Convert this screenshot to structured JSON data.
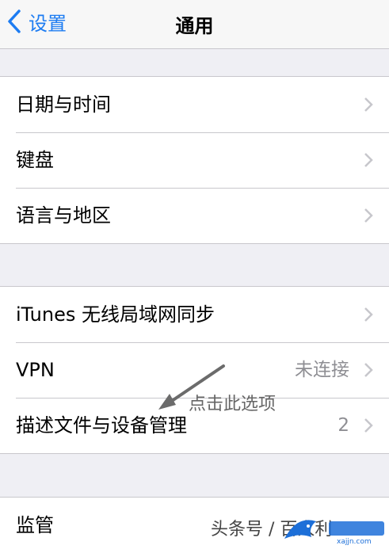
{
  "nav": {
    "back_label": "设置",
    "title": "通用"
  },
  "group1": [
    {
      "label": "日期与时间"
    },
    {
      "label": "键盘"
    },
    {
      "label": "语言与地区"
    }
  ],
  "group2": [
    {
      "label": "iTunes 无线局域网同步"
    },
    {
      "label": "VPN",
      "value": "未连接"
    },
    {
      "label": "描述文件与设备管理",
      "value": "2"
    }
  ],
  "group3": [
    {
      "label": "监管"
    }
  ],
  "annotation": {
    "text": "点击此选项"
  },
  "watermark": {
    "text": "头条号 / 百人利",
    "logo_text": "xajjn.com"
  },
  "colors": {
    "accent": "#1d7cf2",
    "background": "#efeff4",
    "separator": "#c8c7cc",
    "secondary_text": "#8e8e93"
  }
}
